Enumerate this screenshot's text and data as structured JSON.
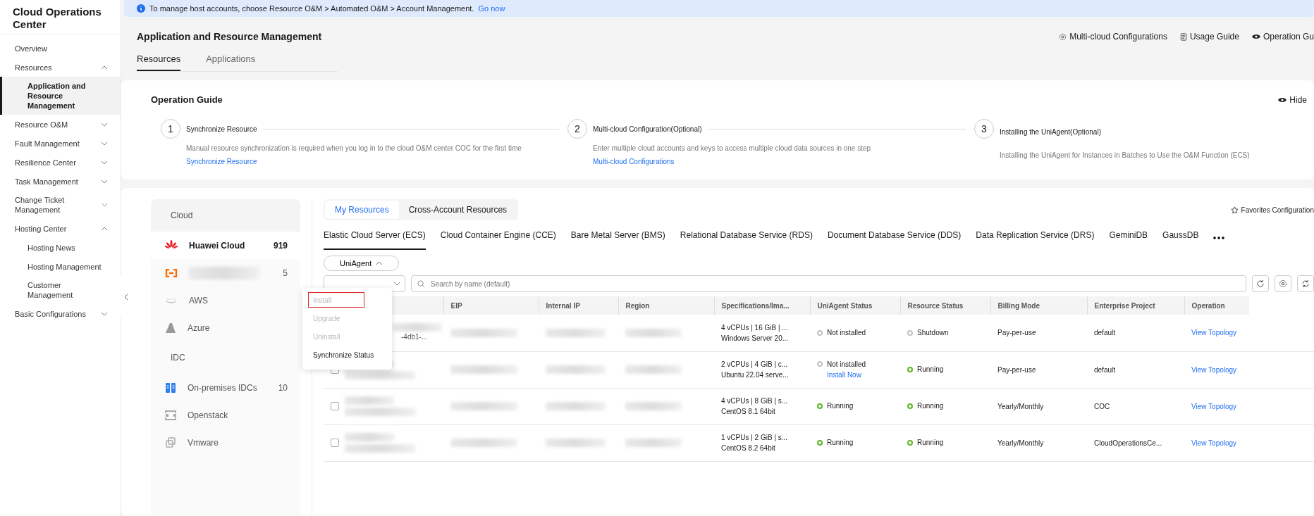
{
  "sidebar": {
    "title": "Cloud Operations Center",
    "items": [
      {
        "label": "Overview",
        "kind": "link",
        "selected": false
      },
      {
        "label": "Resources",
        "kind": "group",
        "expanded": true,
        "selected": false,
        "children": [
          {
            "label": "Application and Resource Management",
            "selected": true
          }
        ]
      },
      {
        "label": "Resource O&M",
        "kind": "group",
        "expanded": false,
        "selected": false
      },
      {
        "label": "Fault Management",
        "kind": "group",
        "expanded": false,
        "selected": false
      },
      {
        "label": "Resilience Center",
        "kind": "group",
        "expanded": false,
        "selected": false
      },
      {
        "label": "Task Management",
        "kind": "group",
        "expanded": false,
        "selected": false
      },
      {
        "label": "Change Ticket Management",
        "kind": "group",
        "expanded": false,
        "selected": false
      },
      {
        "label": "Hosting Center",
        "kind": "group",
        "expanded": true,
        "selected": false,
        "children": [
          {
            "label": "Hosting News",
            "selected": false
          },
          {
            "label": "Hosting Management",
            "selected": false
          },
          {
            "label": "Customer Management",
            "selected": false
          }
        ]
      },
      {
        "label": "Basic Configurations",
        "kind": "group",
        "expanded": false,
        "selected": false
      }
    ]
  },
  "banner": {
    "text": "To manage host accounts, choose Resource O&M > Automated O&M > Account Management.",
    "link": "Go now"
  },
  "header": {
    "title": "Application and Resource Management",
    "actions": [
      {
        "kind": "gear",
        "label": "Multi-cloud Configurations"
      },
      {
        "kind": "doc",
        "label": "Usage Guide"
      },
      {
        "kind": "eye",
        "label": "Operation Gu"
      }
    ],
    "tabs": [
      {
        "label": "Resources",
        "selected": true
      },
      {
        "label": "Applications",
        "selected": false
      }
    ]
  },
  "guide": {
    "title": "Operation Guide",
    "hide": "Hide",
    "steps": [
      {
        "number": "1",
        "title": "Synchronize Resource",
        "description": "Manual resource synchronization is required when you log in to the cloud O&M center COC for the first time",
        "link": "Synchronize Resource"
      },
      {
        "number": "2",
        "title": "Multi-cloud Configuration(Optional)",
        "description": "Enter multiple cloud accounts and keys to access multiple cloud data sources in one step",
        "link": "Multi-cloud Configurations"
      },
      {
        "number": "3",
        "title": "Installing the UniAgent(Optional)",
        "description": "Installing the UniAgent for Instances in Batches to Use the O&M Function (ECS)"
      }
    ]
  },
  "sources": {
    "sections": [
      {
        "title": "Cloud",
        "items": [
          {
            "kind": "huawei",
            "label": "Huawei Cloud",
            "count": "919",
            "selected": true
          },
          {
            "kind": "bracket",
            "count": "5",
            "selected": false
          },
          {
            "kind": "aws",
            "label": "AWS",
            "selected": false
          },
          {
            "kind": "azure",
            "label": "Azure",
            "selected": false
          }
        ]
      },
      {
        "title": "IDC",
        "items": [
          {
            "kind": "idc",
            "label": "On-premises IDCs",
            "count": "10",
            "selected": false
          },
          {
            "kind": "openstack",
            "label": "Openstack",
            "selected": false
          },
          {
            "kind": "vmware",
            "label": "Vmware",
            "selected": false
          }
        ]
      }
    ]
  },
  "scope_tabs": [
    {
      "label": "My Resources",
      "selected": true
    },
    {
      "label": "Cross-Account Resources",
      "selected": false
    }
  ],
  "favorites": "Favorites Configuration",
  "service_tabs": [
    {
      "label": "Elastic Cloud Server (ECS)",
      "selected": true
    },
    {
      "label": "Cloud Container Engine (CCE)",
      "selected": false
    },
    {
      "label": "Bare Metal Server (BMS)",
      "selected": false
    },
    {
      "label": "Relational Database Service (RDS)",
      "selected": false
    },
    {
      "label": "Document Database Service (DDS)",
      "selected": false
    },
    {
      "label": "Data Replication Service (DRS)",
      "selected": false
    },
    {
      "label": "GeminiDB",
      "selected": false
    },
    {
      "label": "GaussDB",
      "selected": false
    }
  ],
  "uniagent_button": {
    "label": "UniAgent",
    "expanded": true
  },
  "menu": [
    {
      "label": "Install",
      "disabled": true,
      "highlighted": true
    },
    {
      "label": "Upgrade",
      "disabled": true,
      "highlighted": false
    },
    {
      "label": "Uninstall",
      "disabled": true,
      "highlighted": false
    },
    {
      "label": "Synchronize Status",
      "disabled": false,
      "highlighted": false
    }
  ],
  "search": {
    "placeholder": "Search by name (default)"
  },
  "table": {
    "columns": [
      "EIP",
      "Internal IP",
      "Region",
      "Specifications/Ima...",
      "UniAgent Status",
      "Resource Status",
      "Billing Mode",
      "Enterprise Project",
      "Operation"
    ],
    "rows": [
      {
        "name_tail": "-4db1-...",
        "spec": "4 vCPUs | 16 GiB | ...",
        "image": "Windows Server 20...",
        "uniagent": {
          "label": "Not installed",
          "color": "#c2c2c2"
        },
        "status": {
          "label": "Shutdown",
          "color": "#c2c2c2"
        },
        "billing": "Pay-per-use",
        "project": "default",
        "operation": "View Topology"
      },
      {
        "checked": false,
        "spec": "2 vCPUs | 4 GiB | c...",
        "image": "Ubuntu 22.04 serve...",
        "uniagent": {
          "label": "Not installed",
          "color": "#c2c2c2",
          "action": "Install Now"
        },
        "status": {
          "label": "Running",
          "color": "#5db524"
        },
        "billing": "Pay-per-use",
        "project": "default",
        "operation": "View Topology"
      },
      {
        "checked": false,
        "spec": "4 vCPUs | 8 GiB | s...",
        "image": "CentOS 8.1 64bit",
        "uniagent": {
          "label": "Running",
          "color": "#5db524"
        },
        "status": {
          "label": "Running",
          "color": "#5db524"
        },
        "billing": "Yearly/Monthly",
        "project": "COC",
        "operation": "View Topology"
      },
      {
        "checked": false,
        "spec": "1 vCPUs | 2 GiB | s...",
        "image": "CentOS 8.2 64bit",
        "uniagent": {
          "label": "Running",
          "color": "#5db524"
        },
        "status": {
          "label": "Running",
          "color": "#5db524"
        },
        "billing": "Yearly/Monthly",
        "project": "CloudOperationsCe...",
        "operation": "View Topology"
      }
    ]
  }
}
